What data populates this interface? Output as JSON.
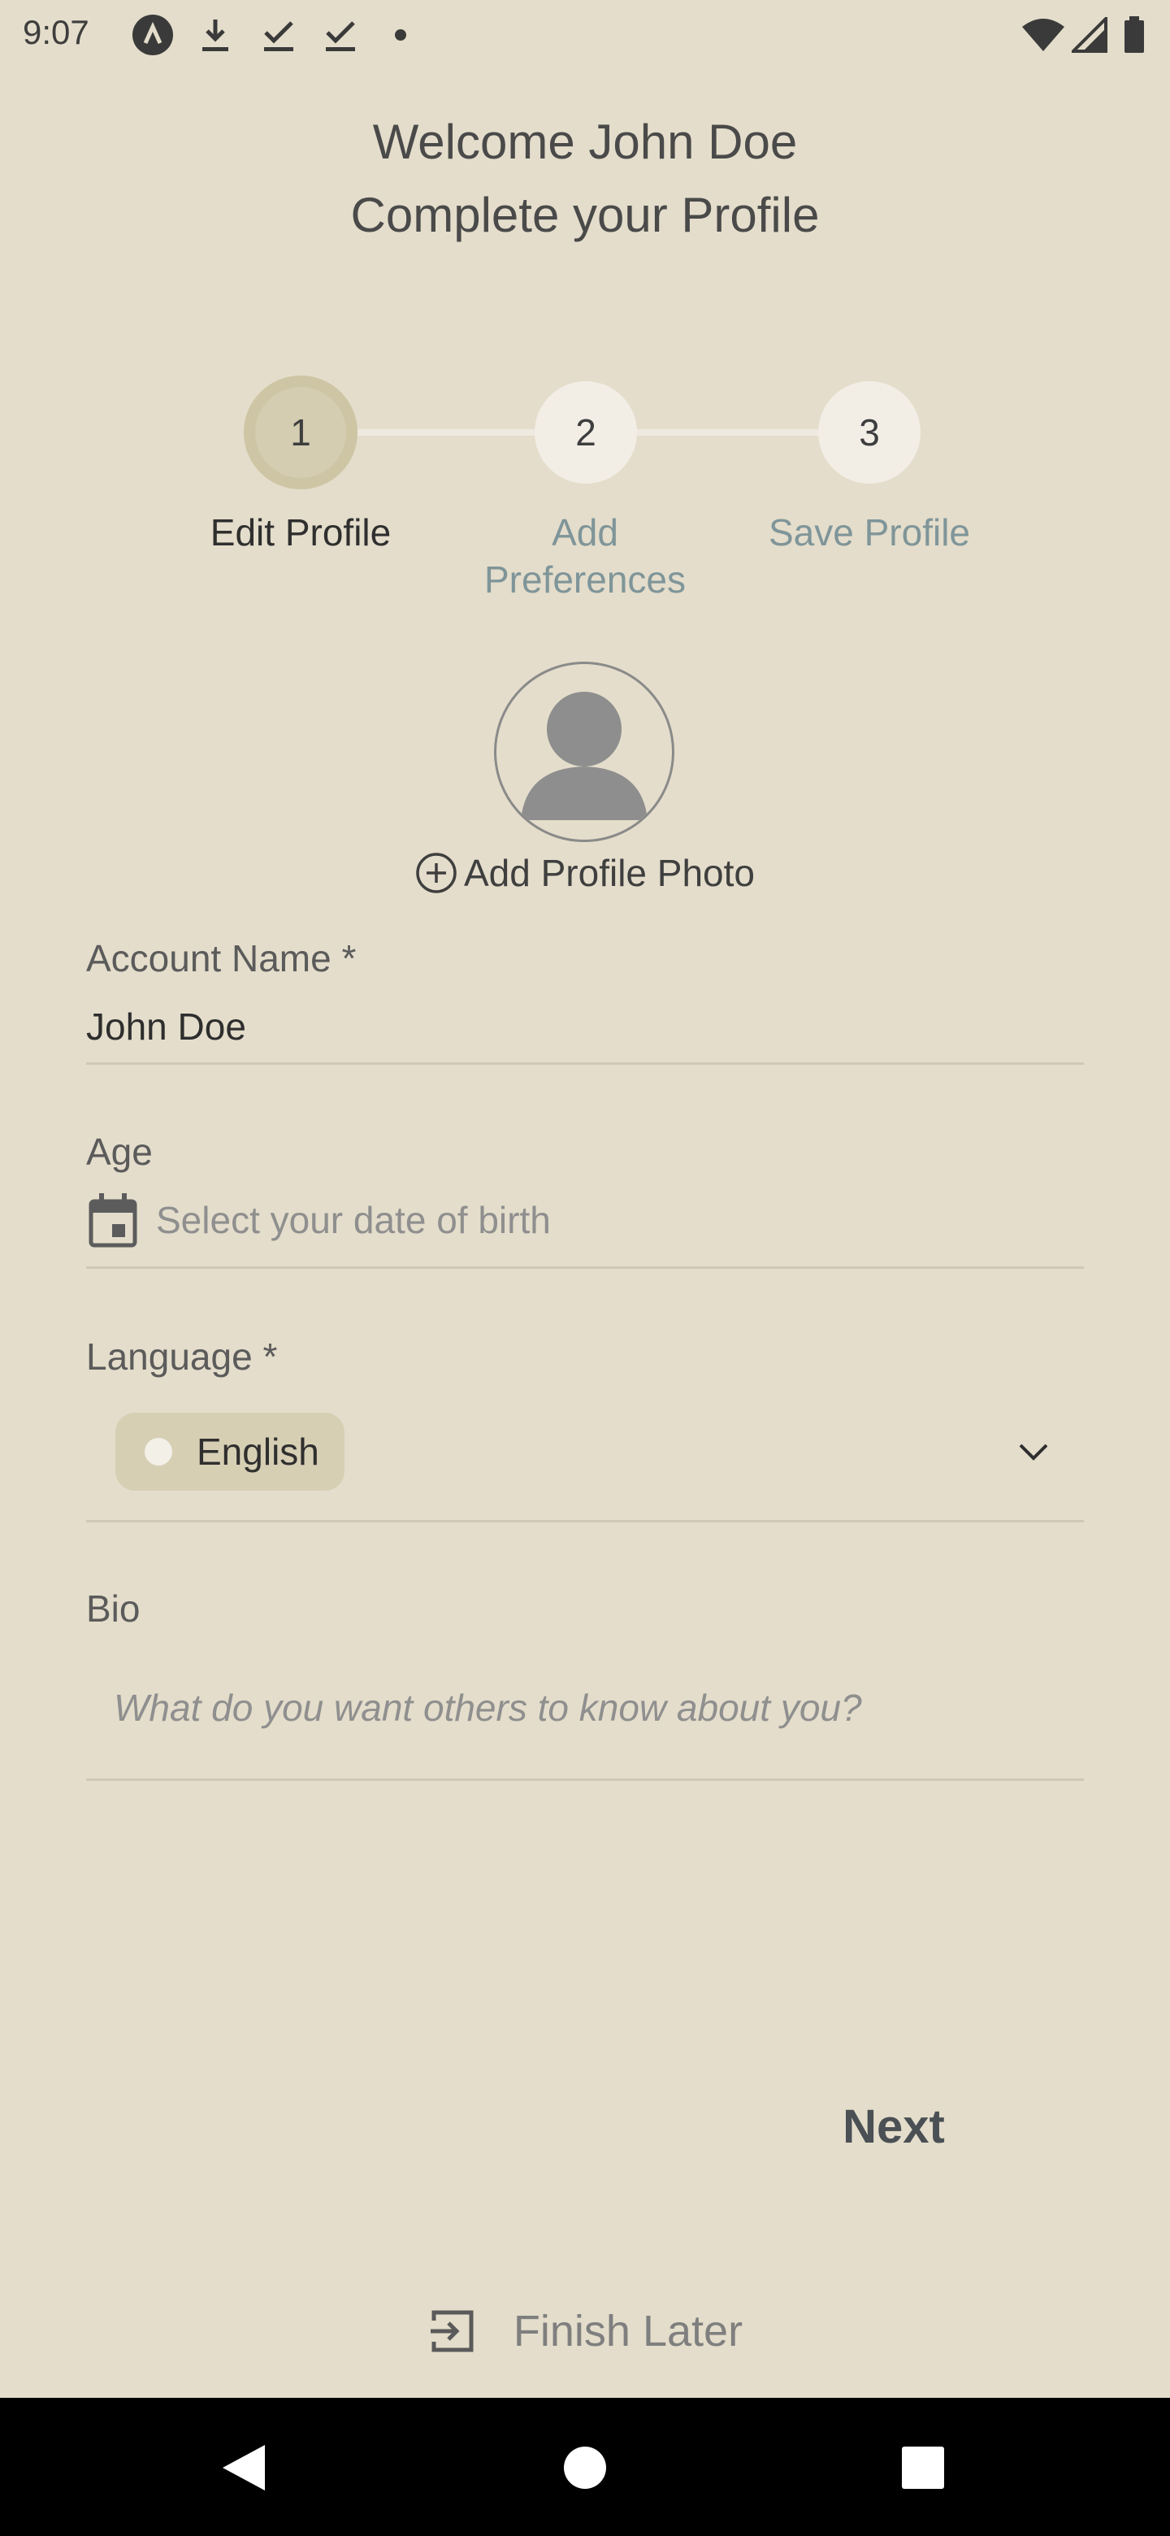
{
  "status_bar": {
    "time": "9:07",
    "left_icons": [
      "app-logo-icon",
      "download-icon",
      "check-download-icon",
      "check-download-icon",
      "dot-icon"
    ],
    "right_icons": [
      "wifi-icon",
      "signal-icon",
      "battery-icon"
    ]
  },
  "header": {
    "welcome": "Welcome John Doe",
    "subtitle": "Complete your Profile"
  },
  "stepper": {
    "steps": [
      {
        "number": "1",
        "label": "Edit Profile",
        "active": true
      },
      {
        "number": "2",
        "label_line1": "Add",
        "label_line2": "Preferences",
        "active": false
      },
      {
        "number": "3",
        "label": "Save Profile",
        "active": false
      }
    ]
  },
  "photo": {
    "add_label": "Add Profile Photo"
  },
  "form": {
    "account_name_label": "Account Name *",
    "account_name_value": "John Doe",
    "age_label": "Age",
    "age_placeholder": "Select your date of birth",
    "language_label": "Language *",
    "language_value": "English",
    "bio_label": "Bio",
    "bio_placeholder": "What do you want others to know about you?"
  },
  "actions": {
    "next_label": "Next",
    "finish_later_label": "Finish Later"
  },
  "colors": {
    "background": "#E4DDCB",
    "step_active": "#D5CDB2",
    "step_inactive_label": "#7F9599",
    "next_text": "#4A5054"
  }
}
